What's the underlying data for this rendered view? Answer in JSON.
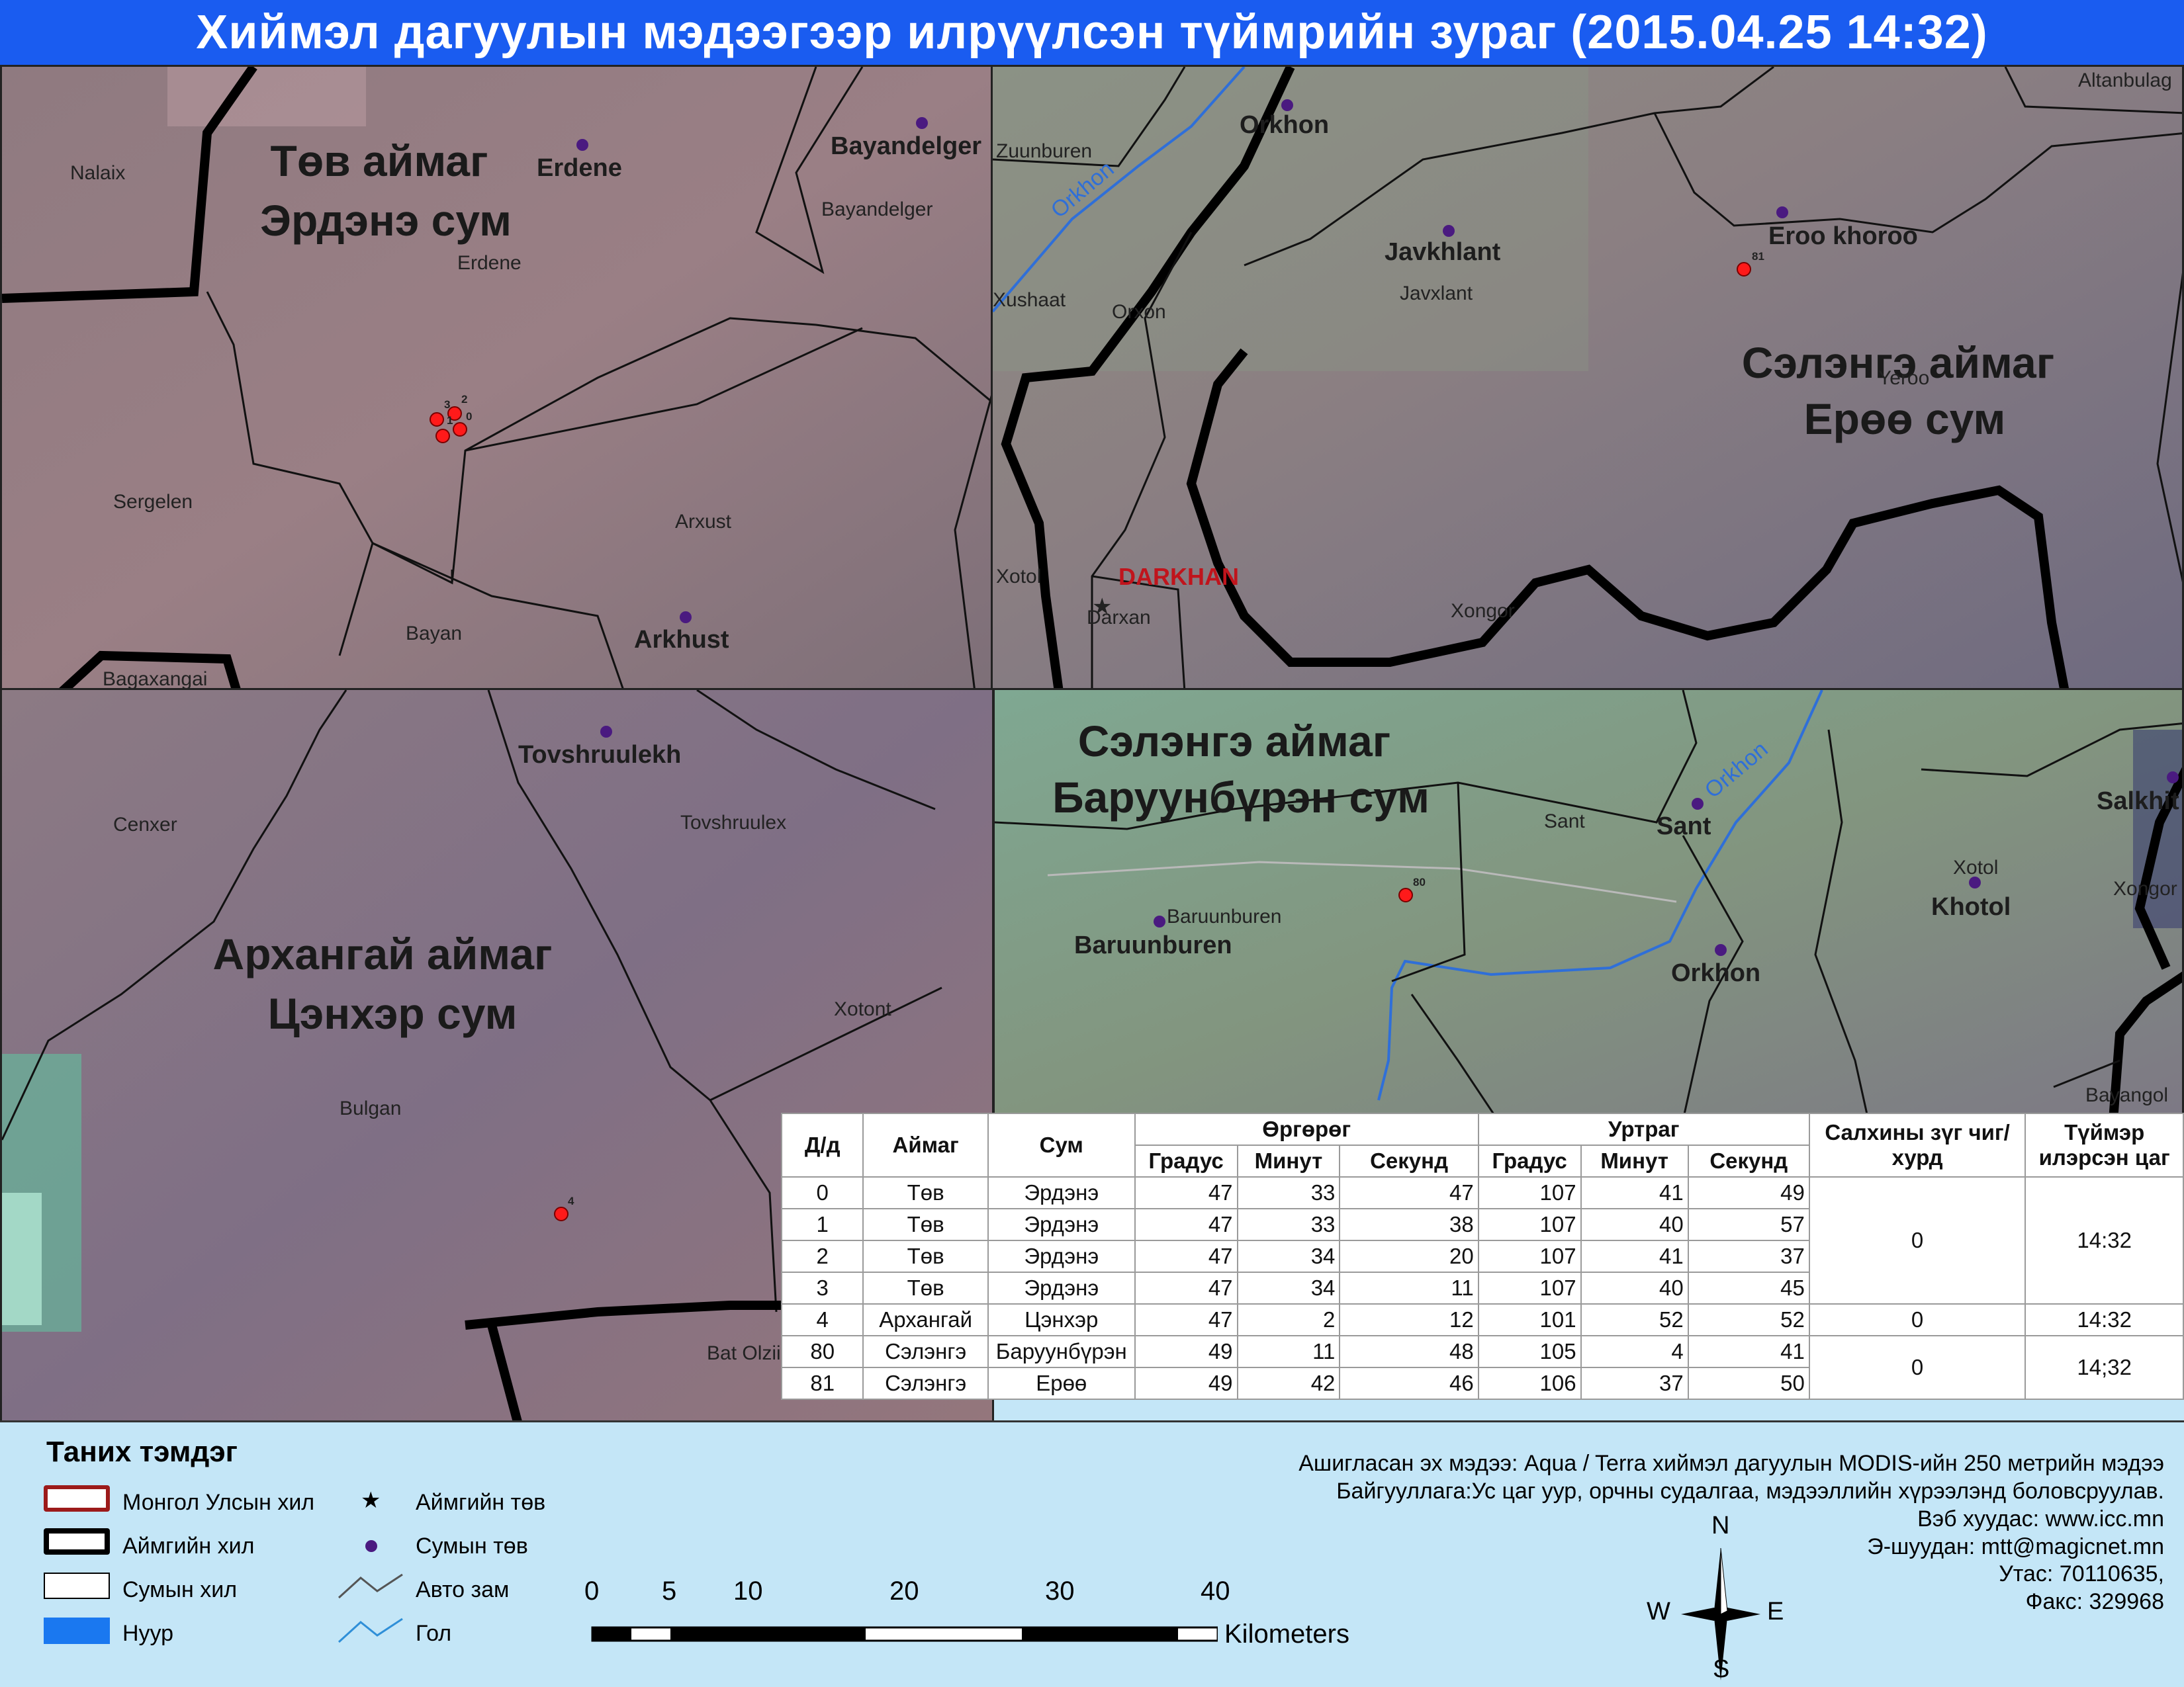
{
  "title": "Хиймэл дагуулын мэдээгээр илрүүлсэн түймрийн зураг  (2015.04.25 14:32)",
  "panels": {
    "tov": {
      "heading1": "Төв аймаг",
      "heading2": "Эрдэнэ сум",
      "labels": [
        "Nalaix",
        "Erdene",
        "Erdene",
        "Bayandelger",
        "Bayandelger",
        "Sergelen",
        "Arxust",
        "Arkhust",
        "Bayan",
        "Bagaxangai"
      ],
      "fire_ids": [
        "3",
        "2",
        "0",
        "1"
      ]
    },
    "selenge_eroo": {
      "heading1": "Сэлэнгэ аймаг",
      "heading2": "Ерөө сум",
      "labels": [
        "Zuunburen",
        "Orkhon",
        "Orkhon",
        "Altanbulag",
        "Javkhlant",
        "Javxlant",
        "Eroo khoroo",
        "Xushaat",
        "Orxon",
        "Yeroo",
        "Xotol",
        "DARKHAN",
        "Darxan",
        "Xongor"
      ],
      "fire_ids": [
        "81"
      ]
    },
    "arkhangai": {
      "heading1": "Архангай аймаг",
      "heading2": "Цэнхэр сум",
      "labels": [
        "Tovshruulekh",
        "Cenxer",
        "Tovshruulex",
        "Xotont",
        "Bulgan",
        "Bat Olzii"
      ],
      "fire_ids": [
        "4"
      ]
    },
    "selenge_baruunburen": {
      "heading1": "Сэлэнгэ аймаг",
      "heading2": "Баруунбүрэн сум",
      "labels": [
        "Orkhon",
        "Sant",
        "Sant",
        "Salkhit",
        "Xotol",
        "Khotol",
        "Xongor",
        "Baruunburen",
        "Baruunburen",
        "Orkhon",
        "Bayangol"
      ],
      "fire_ids": [
        "80"
      ]
    }
  },
  "table": {
    "headers": {
      "id": "Д/д",
      "aimag": "Аймаг",
      "sum": "Сум",
      "lat": "Өргөрөг",
      "lon": "Уртраг",
      "deg": "Градус",
      "min": "Минут",
      "sec": "Секунд",
      "wind": "Салхины зүг чиг/хурд",
      "time": "Түймэр илэрсэн цаг"
    },
    "rows": [
      {
        "id": "0",
        "aimag": "Төв",
        "sum": "Эрдэнэ",
        "lat": [
          "47",
          "33",
          "47"
        ],
        "lon": [
          "107",
          "41",
          "49"
        ]
      },
      {
        "id": "1",
        "aimag": "Төв",
        "sum": "Эрдэнэ",
        "lat": [
          "47",
          "33",
          "38"
        ],
        "lon": [
          "107",
          "40",
          "57"
        ]
      },
      {
        "id": "2",
        "aimag": "Төв",
        "sum": "Эрдэнэ",
        "lat": [
          "47",
          "34",
          "20"
        ],
        "lon": [
          "107",
          "41",
          "37"
        ]
      },
      {
        "id": "3",
        "aimag": "Төв",
        "sum": "Эрдэнэ",
        "lat": [
          "47",
          "34",
          "11"
        ],
        "lon": [
          "107",
          "40",
          "45"
        ]
      },
      {
        "id": "4",
        "aimag": "Архангай",
        "sum": "Цэнхэр",
        "lat": [
          "47",
          "2",
          "12"
        ],
        "lon": [
          "101",
          "52",
          "52"
        ]
      },
      {
        "id": "80",
        "aimag": "Сэлэнгэ",
        "sum": "Баруунбүрэн",
        "lat": [
          "49",
          "11",
          "48"
        ],
        "lon": [
          "105",
          "4",
          "41"
        ]
      },
      {
        "id": "81",
        "aimag": "Сэлэнгэ",
        "sum": "Ерөө",
        "lat": [
          "49",
          "42",
          "46"
        ],
        "lon": [
          "106",
          "37",
          "50"
        ]
      }
    ],
    "groups": [
      {
        "wind": "0",
        "time": "14:32"
      },
      {
        "wind": "0",
        "time": "14:32"
      },
      {
        "wind": "0",
        "time": "14;32"
      }
    ]
  },
  "legend": {
    "title": "Таних тэмдэг",
    "items": {
      "national_border": "Монгол Улсын хил",
      "aimag_border": "Аймгийн хил",
      "sum_border": "Сумын хил",
      "lake": "Нуур",
      "aimag_center": "Аймгийн төв",
      "sum_center": "Сумын төв",
      "road": "Авто зам",
      "river": "Гол"
    }
  },
  "info": {
    "line1": "Ашигласан эх мэдээ: Aqua / Terra хиймэл дагуулын MODIS-ийн 250 метрийн мэдээ",
    "line2": "Байгууллага:Ус цаг уур, орчны судалгаа, мэдээллийн хүрээлэнд боловсруулав.",
    "line3": "Вэб хуудас: www.icc.mn",
    "line4": "Э-шуудан: mtt@magicnet.mn",
    "line5": "Утас: 70110635,",
    "line6": "Факс: 329968"
  },
  "scale": {
    "ticks": [
      "0",
      "5",
      "10",
      "20",
      "30",
      "40"
    ],
    "unit": "Kilometers"
  },
  "compass": {
    "n": "N",
    "s": "S",
    "e": "E",
    "w": "W"
  },
  "colors": {
    "title_bar": "#1a5cf0",
    "fire": "#ff1a1a",
    "sum_center": "#4a1a80",
    "river": "#2f6fd8",
    "national_border": "#9c1a1a",
    "lake": "#1a78f0",
    "legend_bg": "#c4e6f7"
  }
}
